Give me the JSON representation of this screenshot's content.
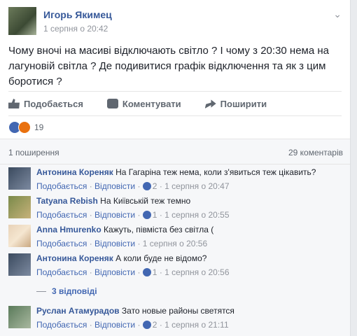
{
  "post": {
    "author": "Игорь Якимец",
    "time": "1 серпня о 20:42",
    "text": "Чому вночі на масиві відключають світло ? І чому з 20:30 нема на лагуновій світла ? Де подивитися графік відключення та як з цим боротися ?",
    "menu_icon": "chevron-down"
  },
  "actions": {
    "like": "Подобається",
    "comment": "Коментувати",
    "share": "Поширити"
  },
  "reactions": {
    "count": "19",
    "types": [
      "like",
      "angry"
    ]
  },
  "stats": {
    "shares": "1 поширення",
    "comments": "29 коментарів"
  },
  "comments": [
    {
      "name": "Антонина Кореняк",
      "text": "На Гагаріна теж нема, коли з'явиться теж цікавить?",
      "like": "Подобається",
      "reply": "Відповісти",
      "likes": "2",
      "time": "1 серпня о 20:47"
    },
    {
      "name": "Tatyana Rebish",
      "text": "На Київській теж темно",
      "like": "Подобається",
      "reply": "Відповісти",
      "likes": "1",
      "time": "1 серпня о 20:55"
    },
    {
      "name": "Anna Hmurenko",
      "text": "Кажуть, півміста без світла (",
      "like": "Подобається",
      "reply": "Відповісти",
      "likes": "",
      "time": "1 серпня о 20:56"
    },
    {
      "name": "Антонина Кореняк",
      "text": "А коли буде не відомо?",
      "like": "Подобається",
      "reply": "Відповісти",
      "likes": "1",
      "time": "1 серпня о 20:56"
    },
    {
      "name": "Руслан Атамурадов",
      "text": "Зато новые районы светятся",
      "like": "Подобається",
      "reply": "Відповісти",
      "likes": "2",
      "time": "1 серпня о 21:11"
    }
  ],
  "replies_label": "3 відповіді",
  "colors": {
    "link": "#365899",
    "accent": "#4267b2",
    "meta": "#90949c",
    "bg": "#f6f7f9"
  }
}
